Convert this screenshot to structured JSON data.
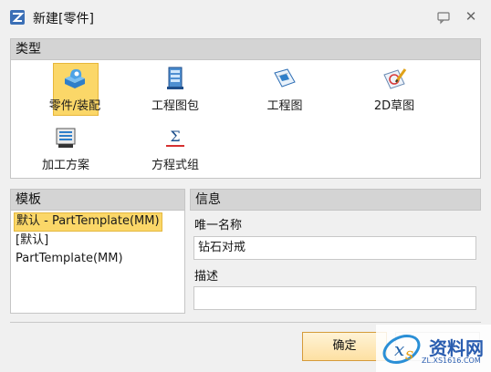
{
  "window": {
    "title": "新建[零件]",
    "icon": "zw3d-app-icon",
    "help_icon": "help-balloon-icon",
    "close_glyph": "✕"
  },
  "type_panel": {
    "header": "类型",
    "items": [
      {
        "label": "零件/装配",
        "icon": "part-assembly-icon",
        "selected": true
      },
      {
        "label": "工程图包",
        "icon": "drawing-pack-icon",
        "selected": false
      },
      {
        "label": "工程图",
        "icon": "drawing-icon",
        "selected": false
      },
      {
        "label": "2D草图",
        "icon": "2d-sketch-icon",
        "selected": false
      },
      {
        "label": "加工方案",
        "icon": "machining-plan-icon",
        "selected": false
      },
      {
        "label": "方程式组",
        "icon": "equation-set-icon",
        "selected": false
      }
    ]
  },
  "template_panel": {
    "header": "模板",
    "items": [
      {
        "label": "默认 - PartTemplate(MM)",
        "selected": true
      },
      {
        "label": "[默认]",
        "selected": false
      },
      {
        "label": "PartTemplate(MM)",
        "selected": false
      }
    ]
  },
  "info_panel": {
    "header": "信息",
    "unique_name_label": "唯一名称",
    "unique_name_value": "钻石对戒",
    "description_label": "描述",
    "description_value": ""
  },
  "buttons": {
    "ok_label": "确定",
    "cancel_label": ""
  },
  "watermark": {
    "text": "资料网",
    "sub": "ZL.XS1616.COM"
  },
  "colors": {
    "selection": "#fbd768",
    "panel_header": "#d4d4d4",
    "accent_blue": "#2a5db0"
  }
}
